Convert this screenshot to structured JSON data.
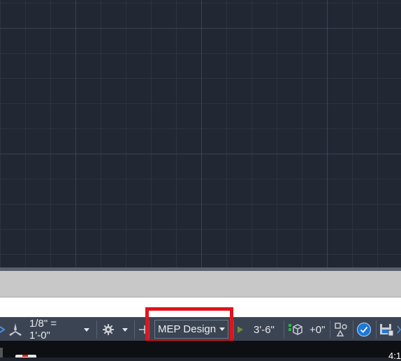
{
  "statusbar": {
    "scale_label": "1/8\" = 1'-0\"",
    "workspace_label": "MEP Design",
    "elevation_label": "3'-6\"",
    "offset_label": "+0\""
  },
  "taskbar": {
    "clock_partial": "4:1"
  },
  "colors": {
    "canvas_bg": "#212733",
    "statusbar_bg": "#3b4453",
    "highlight": "#e1141c",
    "accent_blue": "#1e78d6"
  }
}
